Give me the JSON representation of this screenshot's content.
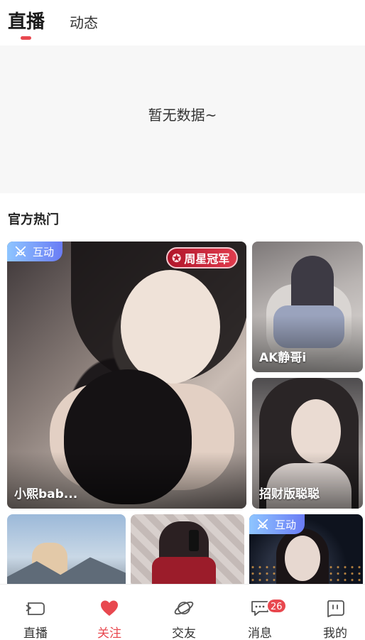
{
  "top_tabs": {
    "live": "直播",
    "feed": "动态"
  },
  "empty_state": {
    "text": "暂无数据~"
  },
  "section": {
    "title": "官方热门"
  },
  "cards": [
    {
      "name": "小熙bab...",
      "badge": "互动",
      "tag": "周星冠军"
    },
    {
      "name": "AK静哥i"
    },
    {
      "name": "招财版聪聪"
    },
    {
      "name": ""
    },
    {
      "name": ""
    },
    {
      "name": "",
      "badge": "互动"
    }
  ],
  "bottom_nav": {
    "items": [
      {
        "label": "直播",
        "icon": "live-icon"
      },
      {
        "label": "关注",
        "icon": "heart-icon"
      },
      {
        "label": "交友",
        "icon": "planet-icon"
      },
      {
        "label": "消息",
        "icon": "message-icon",
        "badge": "26"
      },
      {
        "label": "我的",
        "icon": "profile-icon"
      }
    ],
    "active_index": 1
  },
  "colors": {
    "accent": "#e8484f",
    "badge_start": "#8ec5ff",
    "badge_end": "#6a7cf5"
  }
}
